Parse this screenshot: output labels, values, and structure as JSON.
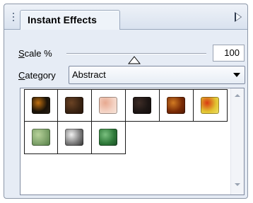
{
  "panel": {
    "title": "Instant Effects",
    "menu_icon": "play-right-triangle-icon"
  },
  "scale": {
    "label_prefix_underlined": "S",
    "label_rest": "cale %",
    "value": "100",
    "slider_level_fraction": 0.47
  },
  "category": {
    "label_prefix_underlined": "C",
    "label_rest": "ategory",
    "selected": "Abstract"
  },
  "effects": [
    {
      "name": "effect-thumbnail-1",
      "colors": [
        "#1a1208",
        "#c07010",
        "#2a2116"
      ]
    },
    {
      "name": "effect-thumbnail-2",
      "colors": [
        "#3b2413",
        "#6b4324",
        "#241207"
      ]
    },
    {
      "name": "effect-thumbnail-3",
      "colors": [
        "#f4d3c4",
        "#e7a88f",
        "#f7e6dc"
      ]
    },
    {
      "name": "effect-thumbnail-4",
      "colors": [
        "#1d1614",
        "#3d2c26",
        "#120c0a"
      ]
    },
    {
      "name": "effect-thumbnail-5",
      "colors": [
        "#7a2b06",
        "#d17a22",
        "#4b1603"
      ]
    },
    {
      "name": "effect-thumbnail-6",
      "colors": [
        "#e2c431",
        "#d93a12",
        "#f1e36b"
      ]
    },
    {
      "name": "effect-thumbnail-7",
      "colors": [
        "#7fa36b",
        "#b7d29a",
        "#4f7a41"
      ]
    },
    {
      "name": "effect-thumbnail-8",
      "colors": [
        "#7c7c7c",
        "#f1f1f1",
        "#2d2d2d"
      ]
    },
    {
      "name": "effect-thumbnail-9",
      "colors": [
        "#2f7a3a",
        "#7ac07f",
        "#184b24"
      ]
    }
  ],
  "colors": {
    "window_bg": "#e6ecf5",
    "border": "#8c97a8",
    "grid_line": "#1b1b1b"
  }
}
